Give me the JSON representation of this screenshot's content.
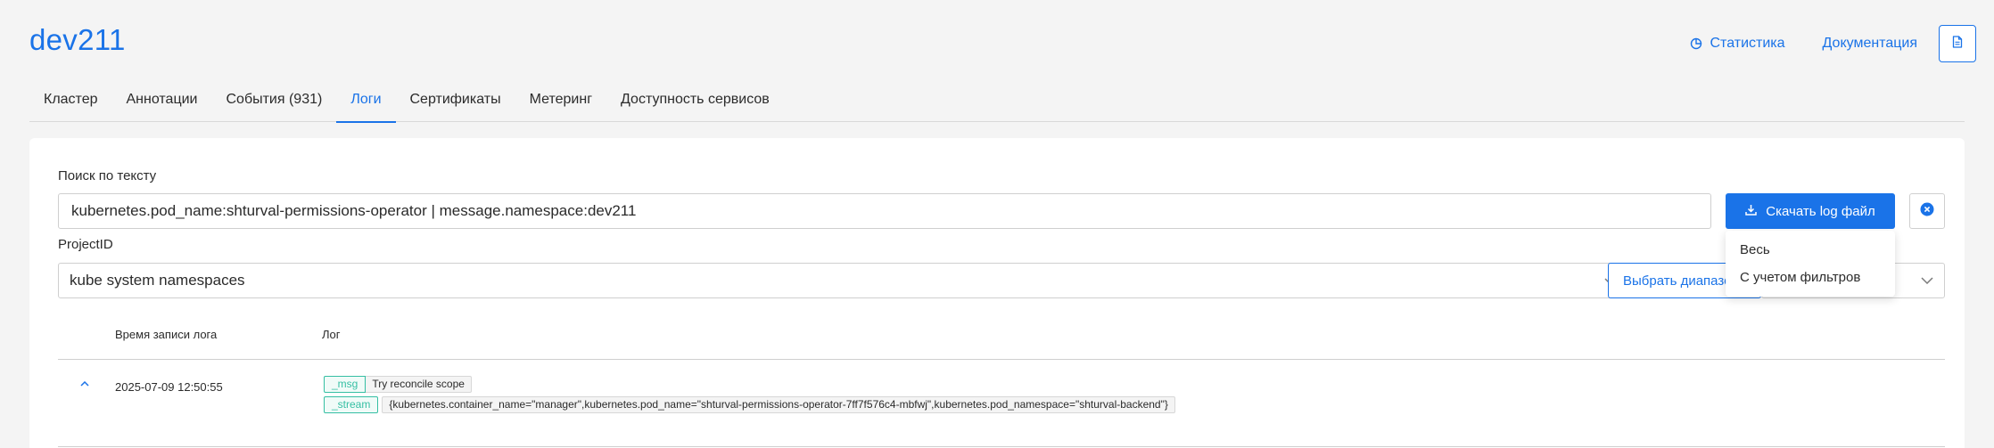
{
  "header": {
    "title": "dev211",
    "stats_label": "Статистика",
    "docs_label": "Документация",
    "doc_button_icon": "document-icon",
    "accent_color": "#1a73e8"
  },
  "tabs": [
    {
      "label": "Кластер",
      "active": false
    },
    {
      "label": "Аннотации",
      "active": false
    },
    {
      "label": "События (931)",
      "active": false
    },
    {
      "label": "Логи",
      "active": true
    },
    {
      "label": "Сертификаты",
      "active": false
    },
    {
      "label": "Метеринг",
      "active": false
    },
    {
      "label": "Доступность сервисов",
      "active": false
    }
  ],
  "search": {
    "label": "Поиск по тексту",
    "value": "kubernetes.pod_name:shturval-permissions-operator | message.namespace:dev211"
  },
  "download": {
    "label": "Скачать log файл",
    "menu": [
      "Весь",
      "С учетом фильтров"
    ]
  },
  "project": {
    "label": "ProjectID",
    "value": "kube system namespaces"
  },
  "range_button": {
    "label": "Выбрать диапазон"
  },
  "table": {
    "columns": {
      "time": "Время записи лога",
      "log": "Лог"
    },
    "rows": [
      {
        "time": "2025-07-09 12:50:55",
        "fields": [
          {
            "key": "_msg",
            "value": "Try reconcile scope"
          },
          {
            "key": "_stream",
            "value": "{kubernetes.container_name=\"manager\",kubernetes.pod_name=\"shturval-permissions-operator-7ff7f576c4-mbfwj\",kubernetes.pod_namespace=\"shturval-backend\"}"
          }
        ]
      }
    ]
  }
}
